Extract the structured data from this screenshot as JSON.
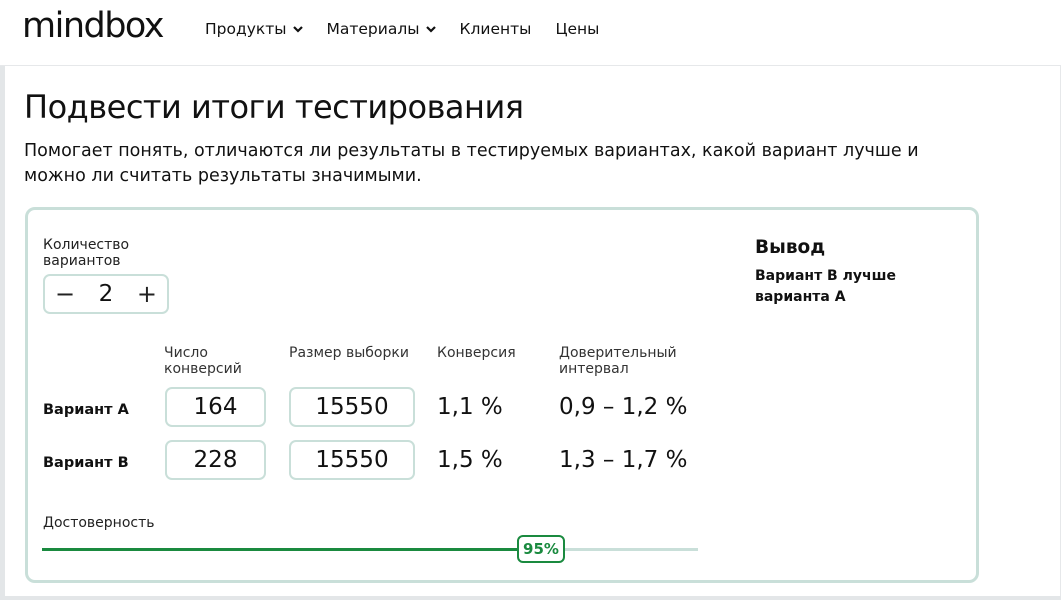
{
  "header": {
    "logo": "mindbox",
    "nav": [
      {
        "label": "Продукты",
        "icon": "chevron-down-icon"
      },
      {
        "label": "Материалы",
        "icon": "chevron-down-icon"
      },
      {
        "label": "Клиенты"
      },
      {
        "label": "Цены"
      }
    ]
  },
  "page": {
    "title": "Подвести итоги тестирования",
    "description": "Помогает понять, отличаются ли результаты в тестируемых вариантах, какой вариант лучше и можно ли считать результаты значимыми."
  },
  "calculator": {
    "variants_label": "Количество вариантов",
    "variants_count": "2",
    "minus_icon": "minus-icon",
    "plus_icon": "plus-icon",
    "columns": [
      "Число конверсий",
      "Размер выборки",
      "Конверсия",
      "Доверительный интервал"
    ],
    "rows": [
      {
        "label": "Вариант A",
        "conversions": "164",
        "sample": "15550",
        "conversion_rate": "1,1 %",
        "interval": "0,9 – 1,2 %"
      },
      {
        "label": "Вариант B",
        "conversions": "228",
        "sample": "15550",
        "conversion_rate": "1,5 %",
        "interval": "1,3 – 1,7 %"
      }
    ],
    "confidence_label": "Достоверность",
    "confidence_value": "95%",
    "confidence_fraction": 0.95,
    "accent_color": "#1a8a3f",
    "border_color": "#c9dfd9"
  },
  "result": {
    "title": "Вывод",
    "text": "Вариант B лучше варианта A"
  }
}
